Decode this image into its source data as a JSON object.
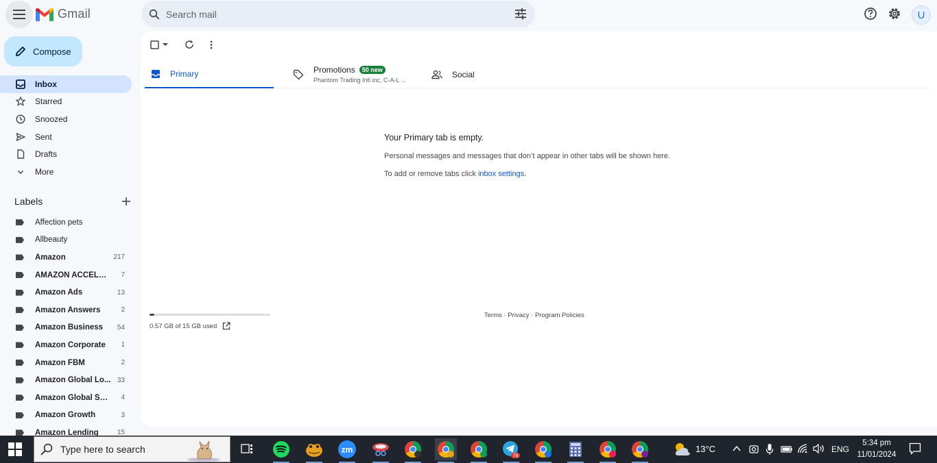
{
  "header": {
    "logo_text": "Gmail",
    "search_placeholder": "Search mail",
    "avatar_letter": "U"
  },
  "sidebar": {
    "compose_label": "Compose",
    "nav": [
      {
        "label": "Inbox",
        "icon": "inbox-icon",
        "active": true
      },
      {
        "label": "Starred",
        "icon": "star-icon"
      },
      {
        "label": "Snoozed",
        "icon": "clock-icon"
      },
      {
        "label": "Sent",
        "icon": "send-icon"
      },
      {
        "label": "Drafts",
        "icon": "draft-icon"
      },
      {
        "label": "More",
        "icon": "chevron-down-icon"
      }
    ],
    "labels_title": "Labels",
    "labels": [
      {
        "name": "Affection pets",
        "count": ""
      },
      {
        "name": "Allbeauty",
        "count": ""
      },
      {
        "name": "Amazon",
        "count": "217"
      },
      {
        "name": "AMAZON ACCELER...",
        "count": "7"
      },
      {
        "name": "Amazon Ads",
        "count": "13"
      },
      {
        "name": "Amazon Answers",
        "count": "2"
      },
      {
        "name": "Amazon Business",
        "count": "54"
      },
      {
        "name": "Amazon Corporate",
        "count": "1"
      },
      {
        "name": "Amazon FBM",
        "count": "2"
      },
      {
        "name": "Amazon Global Lo...",
        "count": "33"
      },
      {
        "name": "Amazon Global Sell...",
        "count": "4"
      },
      {
        "name": "Amazon Growth",
        "count": "3"
      },
      {
        "name": "Amazon Lending",
        "count": "15"
      }
    ]
  },
  "tabs": {
    "primary": "Primary",
    "promotions": "Promotions",
    "promotions_badge": "50 new",
    "promotions_snippet": "Phantom Trading Intl inc, C-A-L ...",
    "social": "Social"
  },
  "empty_state": {
    "title": "Your Primary tab is empty.",
    "line1": "Personal messages and messages that don’t appear in other tabs will be shown here.",
    "line2_prefix": "To add or remove tabs click ",
    "line2_link": "inbox settings",
    "line2_suffix": "."
  },
  "storage": {
    "text": "0.57 GB of 15 GB used",
    "fraction": 0.038
  },
  "footer": {
    "terms": "Terms",
    "sep1": " · ",
    "privacy": "Privacy",
    "sep2": " · ",
    "policies": "Program Policies"
  },
  "taskbar": {
    "search_placeholder": "Type here to search",
    "weather": "13°C",
    "language": "ENG",
    "time": "5:34 pm",
    "date": "11/01/2024",
    "telegram_badge": "78"
  },
  "colors": {
    "accent": "#0b57d0",
    "compose_bg": "#c2e7ff",
    "active_nav": "#d3e3fd",
    "badge_green": "#188038",
    "taskbar_bg": "#20242c"
  }
}
